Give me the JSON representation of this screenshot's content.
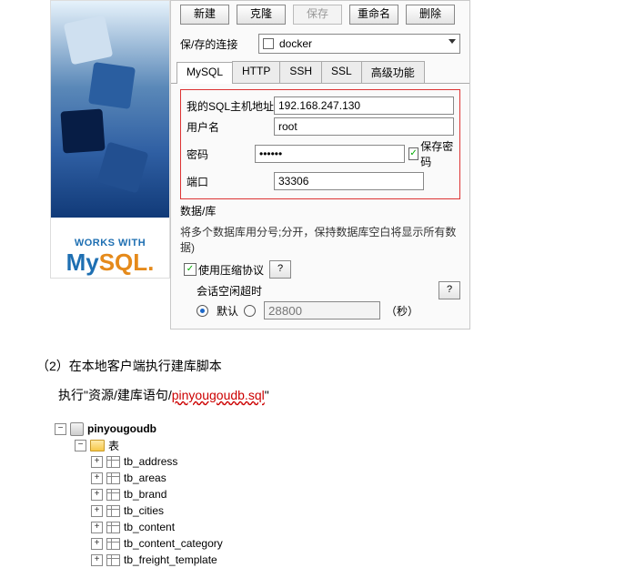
{
  "logo": {
    "works_with": "WORKS WITH",
    "my": "My",
    "sql": "SQL"
  },
  "toolbar": {
    "new": "新建",
    "clone": "克隆",
    "save": "保存",
    "rename": "重命名",
    "delete": "删除"
  },
  "connection": {
    "label": "保/存的连接",
    "value": "docker"
  },
  "tabs": {
    "mysql": "MySQL",
    "http": "HTTP",
    "ssh": "SSH",
    "ssl": "SSL",
    "advanced": "高级功能"
  },
  "form": {
    "host_label": "我的SQL主机地址",
    "host_value": "192.168.247.130",
    "user_label": "用户名",
    "user_value": "root",
    "pass_label": "密码",
    "pass_value": "••••••",
    "save_pass_label": "保存密码",
    "port_label": "端口",
    "port_value": "33306",
    "db_label": "数据/库",
    "db_hint": "将多个数据库用分号;分开，保持数据库空白将显示所有数据)",
    "compress_label": "使用压缩协议",
    "idle_label": "会话空闲超时",
    "default_label": "默认",
    "timeout_value": "28800",
    "seconds_label": "（秒）",
    "help": "?"
  },
  "step2": {
    "title": "（2）在本地客户端执行建库脚本",
    "prefix": "执行\"资源/建库语句/",
    "script": "pinyougoudb.sql",
    "suffix": "\""
  },
  "tree": {
    "db": "pinyougoudb",
    "tables_label": "表",
    "tables": [
      "tb_address",
      "tb_areas",
      "tb_brand",
      "tb_cities",
      "tb_content",
      "tb_content_category",
      "tb_freight_template"
    ]
  }
}
